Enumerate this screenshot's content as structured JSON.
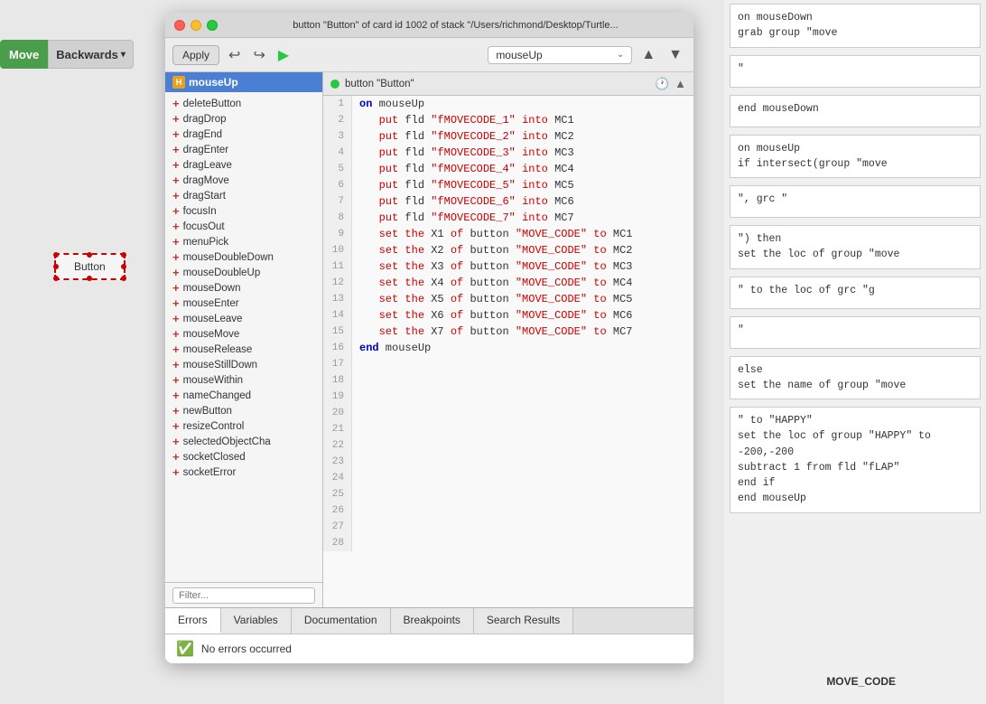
{
  "titleBar": {
    "title": "button \"Button\" of card id 1002 of stack \"/Users/richmond/Desktop/Turtle...",
    "trafficLights": [
      "red",
      "yellow",
      "green"
    ]
  },
  "toolbar": {
    "applyLabel": "Apply",
    "handlerName": "mouseUp"
  },
  "handlerList": {
    "selectedHandler": "mouseUp",
    "hIcon": "H",
    "handlers": [
      "deleteButton",
      "dragDrop",
      "dragEnd",
      "dragEnter",
      "dragLeave",
      "dragMove",
      "dragStart",
      "focusIn",
      "focusOut",
      "menuPick",
      "mouseDoubleDown",
      "mouseDoubleUp",
      "mouseDown",
      "mouseEnter",
      "mouseLeave",
      "mouseMove",
      "mouseRelease",
      "mouseStillDown",
      "mouseWithin",
      "nameChanged",
      "newButton",
      "resizeControl",
      "selectedObjectCha",
      "socketClosed",
      "socketError"
    ],
    "filterPlaceholder": "Filter..."
  },
  "objectBar": {
    "objectName": "button \"Button\""
  },
  "codeLines": [
    {
      "num": 1,
      "content": "on mouseUp",
      "type": "keyword-line"
    },
    {
      "num": 2,
      "content": "   put fld \"fMOVECODE_1\" into MC1",
      "type": "code"
    },
    {
      "num": 3,
      "content": "   put fld \"fMOVECODE_2\" into MC2",
      "type": "code"
    },
    {
      "num": 4,
      "content": "   put fld \"fMOVECODE_3\" into MC3",
      "type": "code"
    },
    {
      "num": 5,
      "content": "   put fld \"fMOVECODE_4\" into MC4",
      "type": "code"
    },
    {
      "num": 6,
      "content": "   put fld \"fMOVECODE_5\" into MC5",
      "type": "code"
    },
    {
      "num": 7,
      "content": "   put fld \"fMOVECODE_6\" into MC6",
      "type": "code"
    },
    {
      "num": 8,
      "content": "   put fld \"fMOVECODE_7\" into MC7",
      "type": "code"
    },
    {
      "num": 9,
      "content": "   set the X1 of button \"MOVE_CODE\" to MC1",
      "type": "code"
    },
    {
      "num": 10,
      "content": "   set the X2 of button \"MOVE_CODE\" to MC2",
      "type": "code"
    },
    {
      "num": 11,
      "content": "   set the X3 of button \"MOVE_CODE\" to MC3",
      "type": "code"
    },
    {
      "num": 12,
      "content": "   set the X4 of button \"MOVE_CODE\" to MC4",
      "type": "code"
    },
    {
      "num": 13,
      "content": "   set the X5 of button \"MOVE_CODE\" to MC5",
      "type": "code"
    },
    {
      "num": 14,
      "content": "   set the X6 of button \"MOVE_CODE\" to MC6",
      "type": "code"
    },
    {
      "num": 15,
      "content": "   set the X7 of button \"MOVE_CODE\" to MC7",
      "type": "code"
    },
    {
      "num": 16,
      "content": "end mouseUp",
      "type": "keyword-line"
    },
    {
      "num": 17,
      "content": "",
      "type": "empty"
    },
    {
      "num": 18,
      "content": "",
      "type": "empty"
    },
    {
      "num": 19,
      "content": "",
      "type": "empty"
    },
    {
      "num": 20,
      "content": "",
      "type": "empty"
    },
    {
      "num": 21,
      "content": "",
      "type": "empty"
    },
    {
      "num": 22,
      "content": "",
      "type": "empty"
    },
    {
      "num": 23,
      "content": "",
      "type": "empty"
    },
    {
      "num": 24,
      "content": "",
      "type": "empty"
    },
    {
      "num": 25,
      "content": "",
      "type": "empty"
    },
    {
      "num": 26,
      "content": "",
      "type": "empty"
    },
    {
      "num": 27,
      "content": "",
      "type": "empty"
    },
    {
      "num": 28,
      "content": "",
      "type": "empty"
    }
  ],
  "bottomTabs": {
    "tabs": [
      "Errors",
      "Variables",
      "Documentation",
      "Breakpoints",
      "Search Results"
    ],
    "activeTab": "Errors"
  },
  "statusBar": {
    "message": "No errors occurred"
  },
  "rightPanel": {
    "snippets": [
      "on mouseDown\ngrab group \"move",
      "\"",
      "end mouseDown",
      "on mouseUp\nif intersect(group \"move",
      "\", grc \"",
      "\") then\nset the loc of group \"move",
      "\" to the loc of grc \"g",
      "\"",
      "else\nset the name of group \"move",
      "\" to \"HAPPY\"\nset the loc of group \"HAPPY\" to\n-200,-200\nsubtract 1 from fld \"fLAP\"\nend if\nend mouseUp"
    ]
  },
  "moveBackwards": {
    "moveLabel": "Move",
    "backwardsLabel": "Backwards"
  },
  "buttonWidget": {
    "label": "Button"
  },
  "moveCodeLabel": "MOVE_CODE"
}
